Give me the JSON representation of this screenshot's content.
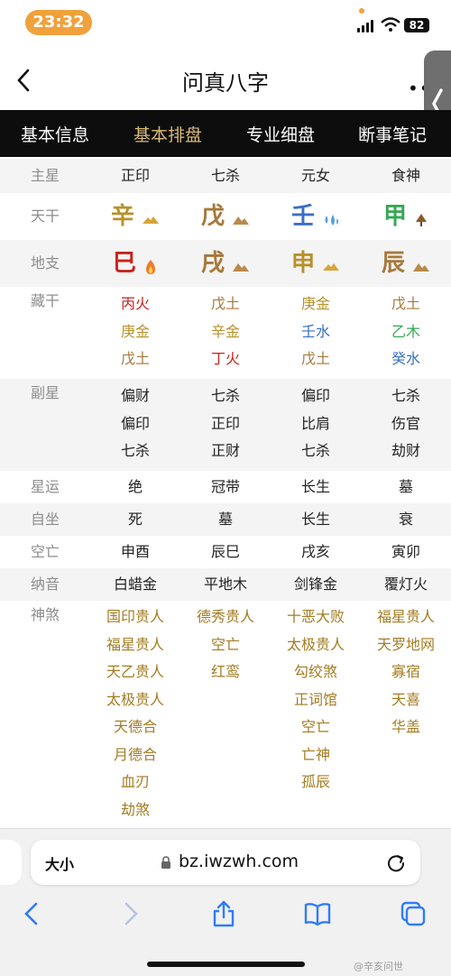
{
  "status": {
    "time": "23:32",
    "battery": "82"
  },
  "header": {
    "title": "问真八字",
    "more": "••"
  },
  "tabs": [
    "基本信息",
    "基本排盘",
    "专业细盘",
    "断事笔记"
  ],
  "labels": {
    "zhuxing": "主星",
    "tiangan": "天干",
    "dizhi": "地支",
    "canggan": "藏干",
    "fuxing": "副星",
    "xingyun": "星运",
    "zizuo": "自坐",
    "kongwang": "空亡",
    "nayin": "纳音",
    "shensha": "神煞"
  },
  "zhuxing": [
    "正印",
    "七杀",
    "元女",
    "食神"
  ],
  "tiangan": [
    "辛",
    "戊",
    "壬",
    "甲"
  ],
  "dizhi": [
    "巳",
    "戌",
    "申",
    "辰"
  ],
  "canggan": [
    [
      "丙火",
      "庚金",
      "戊土"
    ],
    [
      "戊土",
      "辛金",
      "丁火"
    ],
    [
      "庚金",
      "壬水",
      "戊土"
    ],
    [
      "戊土",
      "乙木",
      "癸水"
    ]
  ],
  "fuxing": [
    [
      "偏财",
      "偏印",
      "七杀"
    ],
    [
      "七杀",
      "正印",
      "正财"
    ],
    [
      "偏印",
      "比肩",
      "七杀"
    ],
    [
      "七杀",
      "伤官",
      "劫财"
    ]
  ],
  "xingyun": [
    "绝",
    "冠带",
    "长生",
    "墓"
  ],
  "zizuo": [
    "死",
    "墓",
    "长生",
    "衰"
  ],
  "kongwang": [
    "申酉",
    "辰巳",
    "戌亥",
    "寅卯"
  ],
  "nayin": [
    "白蜡金",
    "平地木",
    "剑锋金",
    "覆灯火"
  ],
  "shensha": [
    [
      "国印贵人",
      "福星贵人",
      "天乙贵人",
      "太极贵人",
      "天德合",
      "月德合",
      "血刃",
      "劫煞"
    ],
    [
      "德秀贵人",
      "空亡",
      "红鸾"
    ],
    [
      "十恶大败",
      "太极贵人",
      "勾绞煞",
      "正词馆",
      "空亡",
      "亡神",
      "孤辰"
    ],
    [
      "福星贵人",
      "天罗地网",
      "寡宿",
      "天喜",
      "华盖"
    ]
  ],
  "browser": {
    "aa": "大小",
    "url": "bz.iwzwh.com"
  },
  "watermark": "@辛亥问世",
  "colors": {
    "tab_active": "#d8b977",
    "metal": "#b8912a",
    "fire": "#c9231b",
    "earth": "#a7783a",
    "water": "#3a6fc4",
    "wood": "#34a853",
    "shensha": "#a37c22"
  }
}
